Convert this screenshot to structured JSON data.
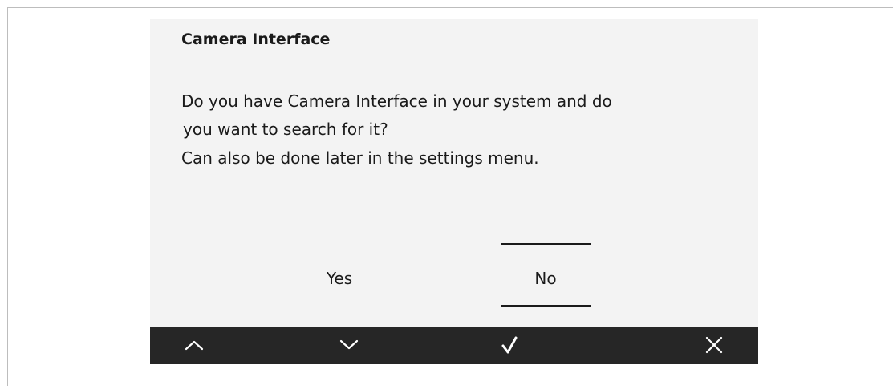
{
  "dialog": {
    "title": "Camera Interface",
    "message_lines": [
      "Do you have Camera Interface in your system and do",
      "you want to search for it?",
      "Can also be done later in the settings menu."
    ],
    "options": {
      "yes_label": "Yes",
      "no_label": "No",
      "selected": "No"
    }
  },
  "navbar": {
    "buttons": [
      {
        "icon": "chevron-up-icon"
      },
      {
        "icon": "chevron-down-icon"
      },
      {
        "icon": "checkmark-icon"
      },
      {
        "icon": "close-icon"
      }
    ]
  },
  "colors": {
    "screen_background": "#f3f3f3",
    "navbar_background": "#262626",
    "text": "#1a1a1a",
    "icon": "#ffffff"
  }
}
